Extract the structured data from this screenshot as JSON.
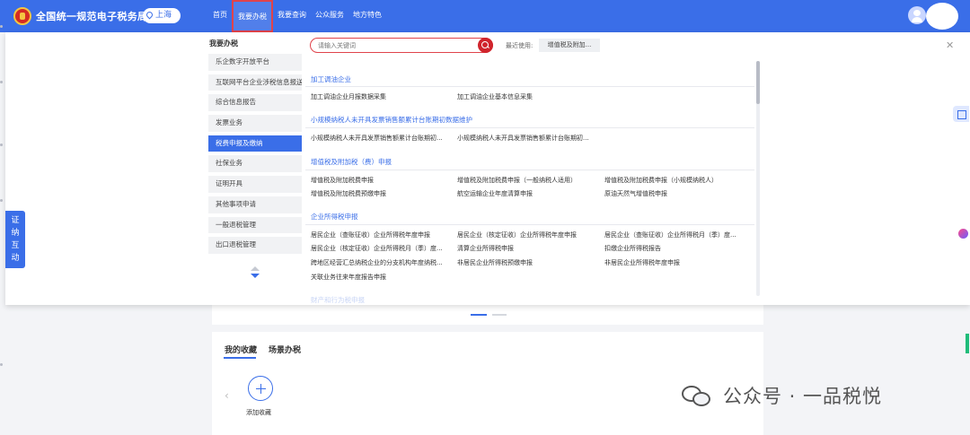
{
  "header": {
    "site_title": "全国统一规范电子税务局",
    "region": "上海",
    "nav": [
      "首页",
      "我要办税",
      "我要查询",
      "公众服务",
      "地方特色"
    ]
  },
  "sidebar": {
    "title": "我要办税",
    "items": [
      "乐企数字开放平台",
      "互联网平台企业涉税信息报送",
      "综合信息报告",
      "发票业务",
      "税费申报及缴纳",
      "社保业务",
      "证明开具",
      "其他事项申请",
      "一般退税管理",
      "出口退税管理"
    ],
    "active_index": 4
  },
  "search": {
    "placeholder": "请输入关键词",
    "recent_label": "最近使用:",
    "recent_item": "增值税及附加..."
  },
  "sections": [
    {
      "title": "加工调油企业",
      "items": [
        "加工调油企业月报数据采集",
        "加工调油企业基本信息采集"
      ]
    },
    {
      "title": "小规模纳税人未开具发票销售额累计台账期初数据维护",
      "items": [
        "小规模纳税人未开具发票销售额累计台账期初...",
        "小规模纳税人未开具发票销售额累计台账期初..."
      ]
    },
    {
      "title": "增值税及附加税（费）申报",
      "items": [
        "增值税及附加税费申报",
        "增值税及附加税费申报（一般纳税人适用）",
        "增值税及附加税费申报（小规模纳税人）",
        "增值税及附加税费预缴申报",
        "航空运输企业年度清算申报",
        "原油天然气增值税申报"
      ]
    },
    {
      "title": "企业所得税申报",
      "items": [
        "居民企业（查账征收）企业所得税年度申报",
        "居民企业（核定征收）企业所得税年度申报",
        "居民企业（查账征收）企业所得税月（季）度...",
        "居民企业（核定征收）企业所得税月（季）度...",
        "清算企业所得税申报",
        "扣缴企业所得税报告",
        "跨地区经营汇总纳税企业的分支机构年度纳税...",
        "非居民企业所得税预缴申报",
        "非居民企业所得税年度申报",
        "关联业务往来年度报告申报"
      ]
    }
  ],
  "faded_next_section": "财产和行为税申报",
  "float_tab": [
    "证",
    "纳",
    "互",
    "动"
  ],
  "main": {
    "tabs": [
      "我的收藏",
      "场景办税"
    ],
    "add_label": "添加收藏"
  },
  "watermark": "公众号 · 一品税悦",
  "colors": {
    "primary": "#3a6ee8",
    "highlight": "#e0434b"
  }
}
